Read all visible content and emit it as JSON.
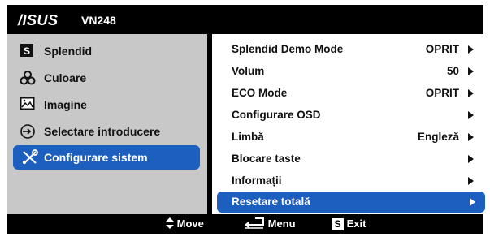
{
  "header": {
    "logo": "/ISUS",
    "model": "VN248"
  },
  "left_menu": [
    {
      "label": "Splendid",
      "icon": "splendid-s-icon"
    },
    {
      "label": "Culoare",
      "icon": "color-icon"
    },
    {
      "label": "Imagine",
      "icon": "image-icon"
    },
    {
      "label": "Selectare introducere",
      "icon": "input-select-icon"
    },
    {
      "label": "Configurare sistem",
      "icon": "tools-icon",
      "active": true
    }
  ],
  "right_menu": [
    {
      "label": "Splendid Demo Mode",
      "value": "OPRIT"
    },
    {
      "label": "Volum",
      "value": "50"
    },
    {
      "label": "ECO Mode",
      "value": "OPRIT"
    },
    {
      "label": "Configurare OSD",
      "value": ""
    },
    {
      "label": "Limbă",
      "value": "Engleză"
    },
    {
      "label": "Blocare taste",
      "value": ""
    },
    {
      "label": "Informații",
      "value": ""
    },
    {
      "label": "Resetare totală",
      "value": "",
      "active": true
    }
  ],
  "footer": {
    "move": "Move",
    "menu": "Menu",
    "exit": "Exit",
    "exit_badge": "S"
  },
  "colors": {
    "accent": "#1d5fbf",
    "panel_left": "#c8c8c8",
    "panel_right": "#ffffff",
    "frame": "#000000"
  }
}
